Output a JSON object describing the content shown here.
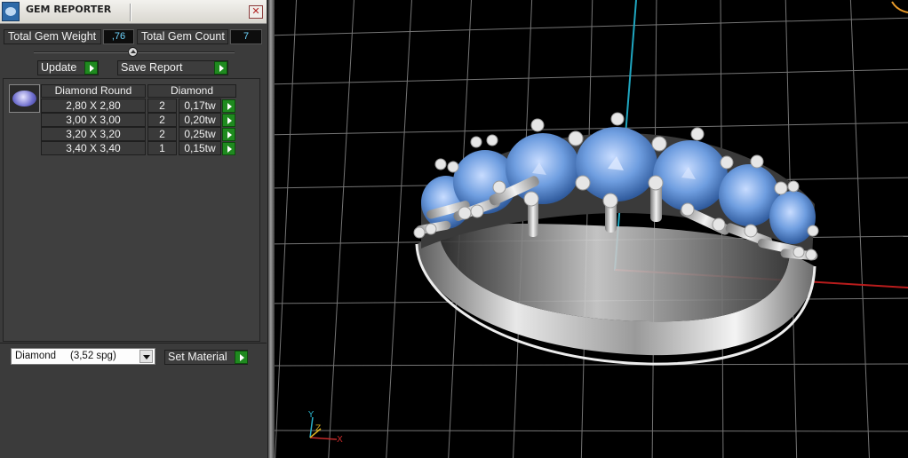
{
  "panel": {
    "title": "GEM REPORTER",
    "close_label": "✕",
    "total_weight_label": "Total Gem Weight",
    "total_weight_value": ",76",
    "total_count_label": "Total Gem Count",
    "total_count_value": "7",
    "update_label": "Update",
    "save_label": "Save Report"
  },
  "table": {
    "headers": [
      "Diamond Round",
      "Diamond"
    ],
    "rows": [
      {
        "size": "2,80 X 2,80",
        "count": "2",
        "weight": "0,17tw"
      },
      {
        "size": "3,00 X 3,00",
        "count": "2",
        "weight": "0,20tw"
      },
      {
        "size": "3,20 X 3,20",
        "count": "2",
        "weight": "0,25tw"
      },
      {
        "size": "3,40 X 3,40",
        "count": "1",
        "weight": "0,15tw"
      }
    ]
  },
  "material": {
    "selected": "Diamond     (3,52 spg)",
    "set_label": "Set Material"
  },
  "viewport": {
    "axis_y": "Y",
    "axis_x": "X",
    "axis_z": "Z",
    "colors": {
      "grid": "#8a8a8a",
      "x_axis": "#b81c1c",
      "y_axis": "#1fa6c0",
      "gem": "#6f9ee0",
      "metal": "#c9c9c9"
    }
  }
}
